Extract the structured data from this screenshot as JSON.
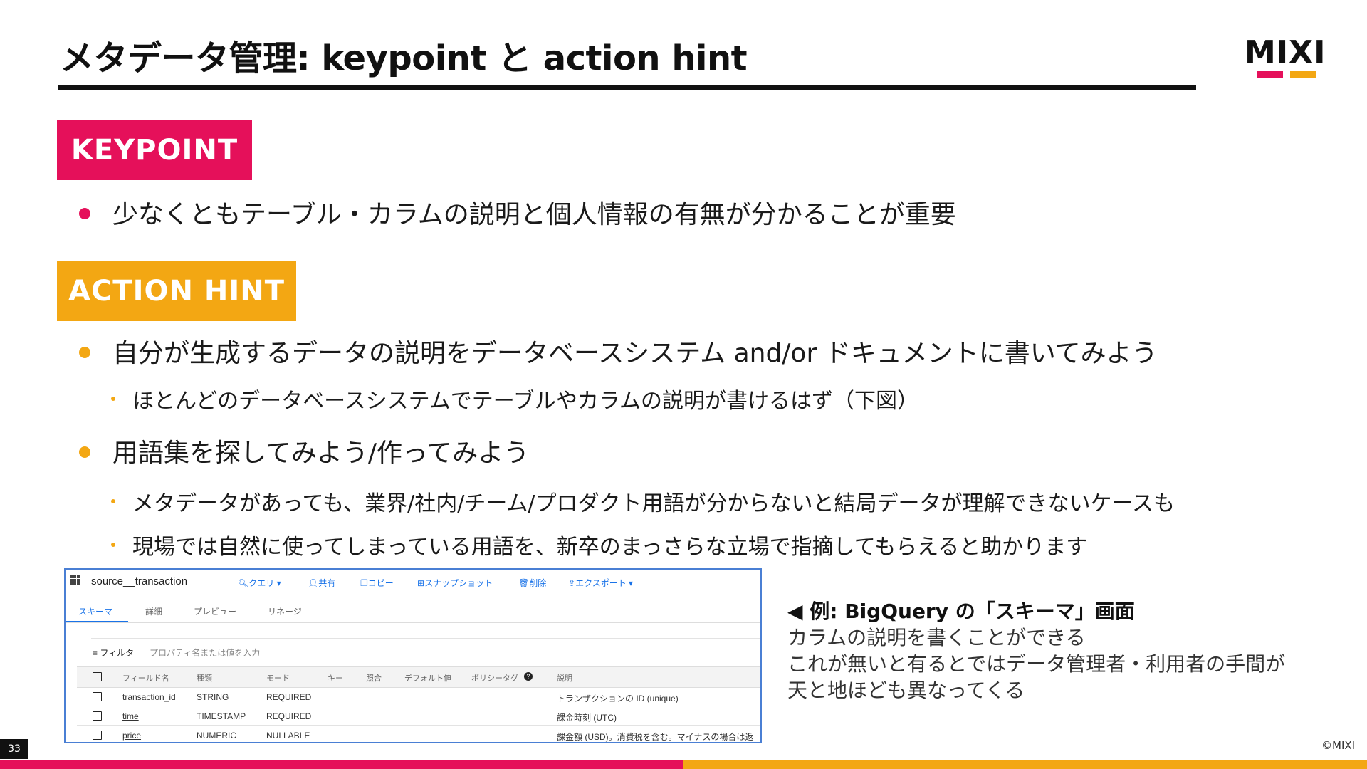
{
  "slide": {
    "title": "メタデータ管理: keypoint と action hint",
    "logo_text": "MIXI",
    "page_number": "33",
    "copyright": "©MIXI"
  },
  "keypoint": {
    "tag": "KEYPOINT",
    "bullets": [
      "少なくともテーブル・カラムの説明と個人情報の有無が分かることが重要"
    ]
  },
  "action_hint": {
    "tag": "ACTION HINT",
    "item1": {
      "text": "自分が生成するデータの説明をデータベースシステム and/or ドキュメントに書いてみよう",
      "sub": [
        "ほとんどのデータベースシステムでテーブルやカラムの説明が書けるはず（下図）"
      ]
    },
    "item2": {
      "text": "用語集を探してみよう/作ってみよう",
      "sub": [
        "メタデータがあっても、業界/社内/チーム/プロダクト用語が分からないと結局データが理解できないケースも",
        "現場では自然に使ってしまっている用語を、新卒のまっさらな立場で指摘してもらえると助かります"
      ]
    }
  },
  "bigquery": {
    "table_name": "source__transaction",
    "toolbar": [
      "クエリ ▾",
      "共有",
      "コピー",
      "スナップショット",
      "削除",
      "エクスポート ▾"
    ],
    "tabs": [
      "スキーマ",
      "詳細",
      "プレビュー",
      "リネージ"
    ],
    "filter_label": "フィルタ",
    "filter_placeholder": "プロパティ名または値を入力",
    "columns": [
      "フィールド名",
      "種類",
      "モード",
      "キー",
      "照合",
      "デフォルト値",
      "ポリシータグ",
      "説明"
    ],
    "rows": [
      {
        "name": "transaction_id",
        "type": "STRING",
        "mode": "REQUIRED",
        "desc": "トランザクションの ID (unique)"
      },
      {
        "name": "time",
        "type": "TIMESTAMP",
        "mode": "REQUIRED",
        "desc": "課金時刻 (UTC)"
      },
      {
        "name": "price",
        "type": "NUMERIC",
        "mode": "NULLABLE",
        "desc": "課金額 (USD)。消費税を含む。マイナスの場合は返"
      }
    ]
  },
  "caption": {
    "head": "◀ 例: BigQuery の「スキーマ」画面",
    "lines": [
      "カラムの説明を書くことができる",
      "これが無いと有るとではデータ管理者・利用者の手間が",
      "天と地ほども異なってくる"
    ]
  },
  "colors": {
    "accent_pink": "#e5105a",
    "accent_orange": "#f3a713",
    "bq_blue": "#1a73e8"
  }
}
